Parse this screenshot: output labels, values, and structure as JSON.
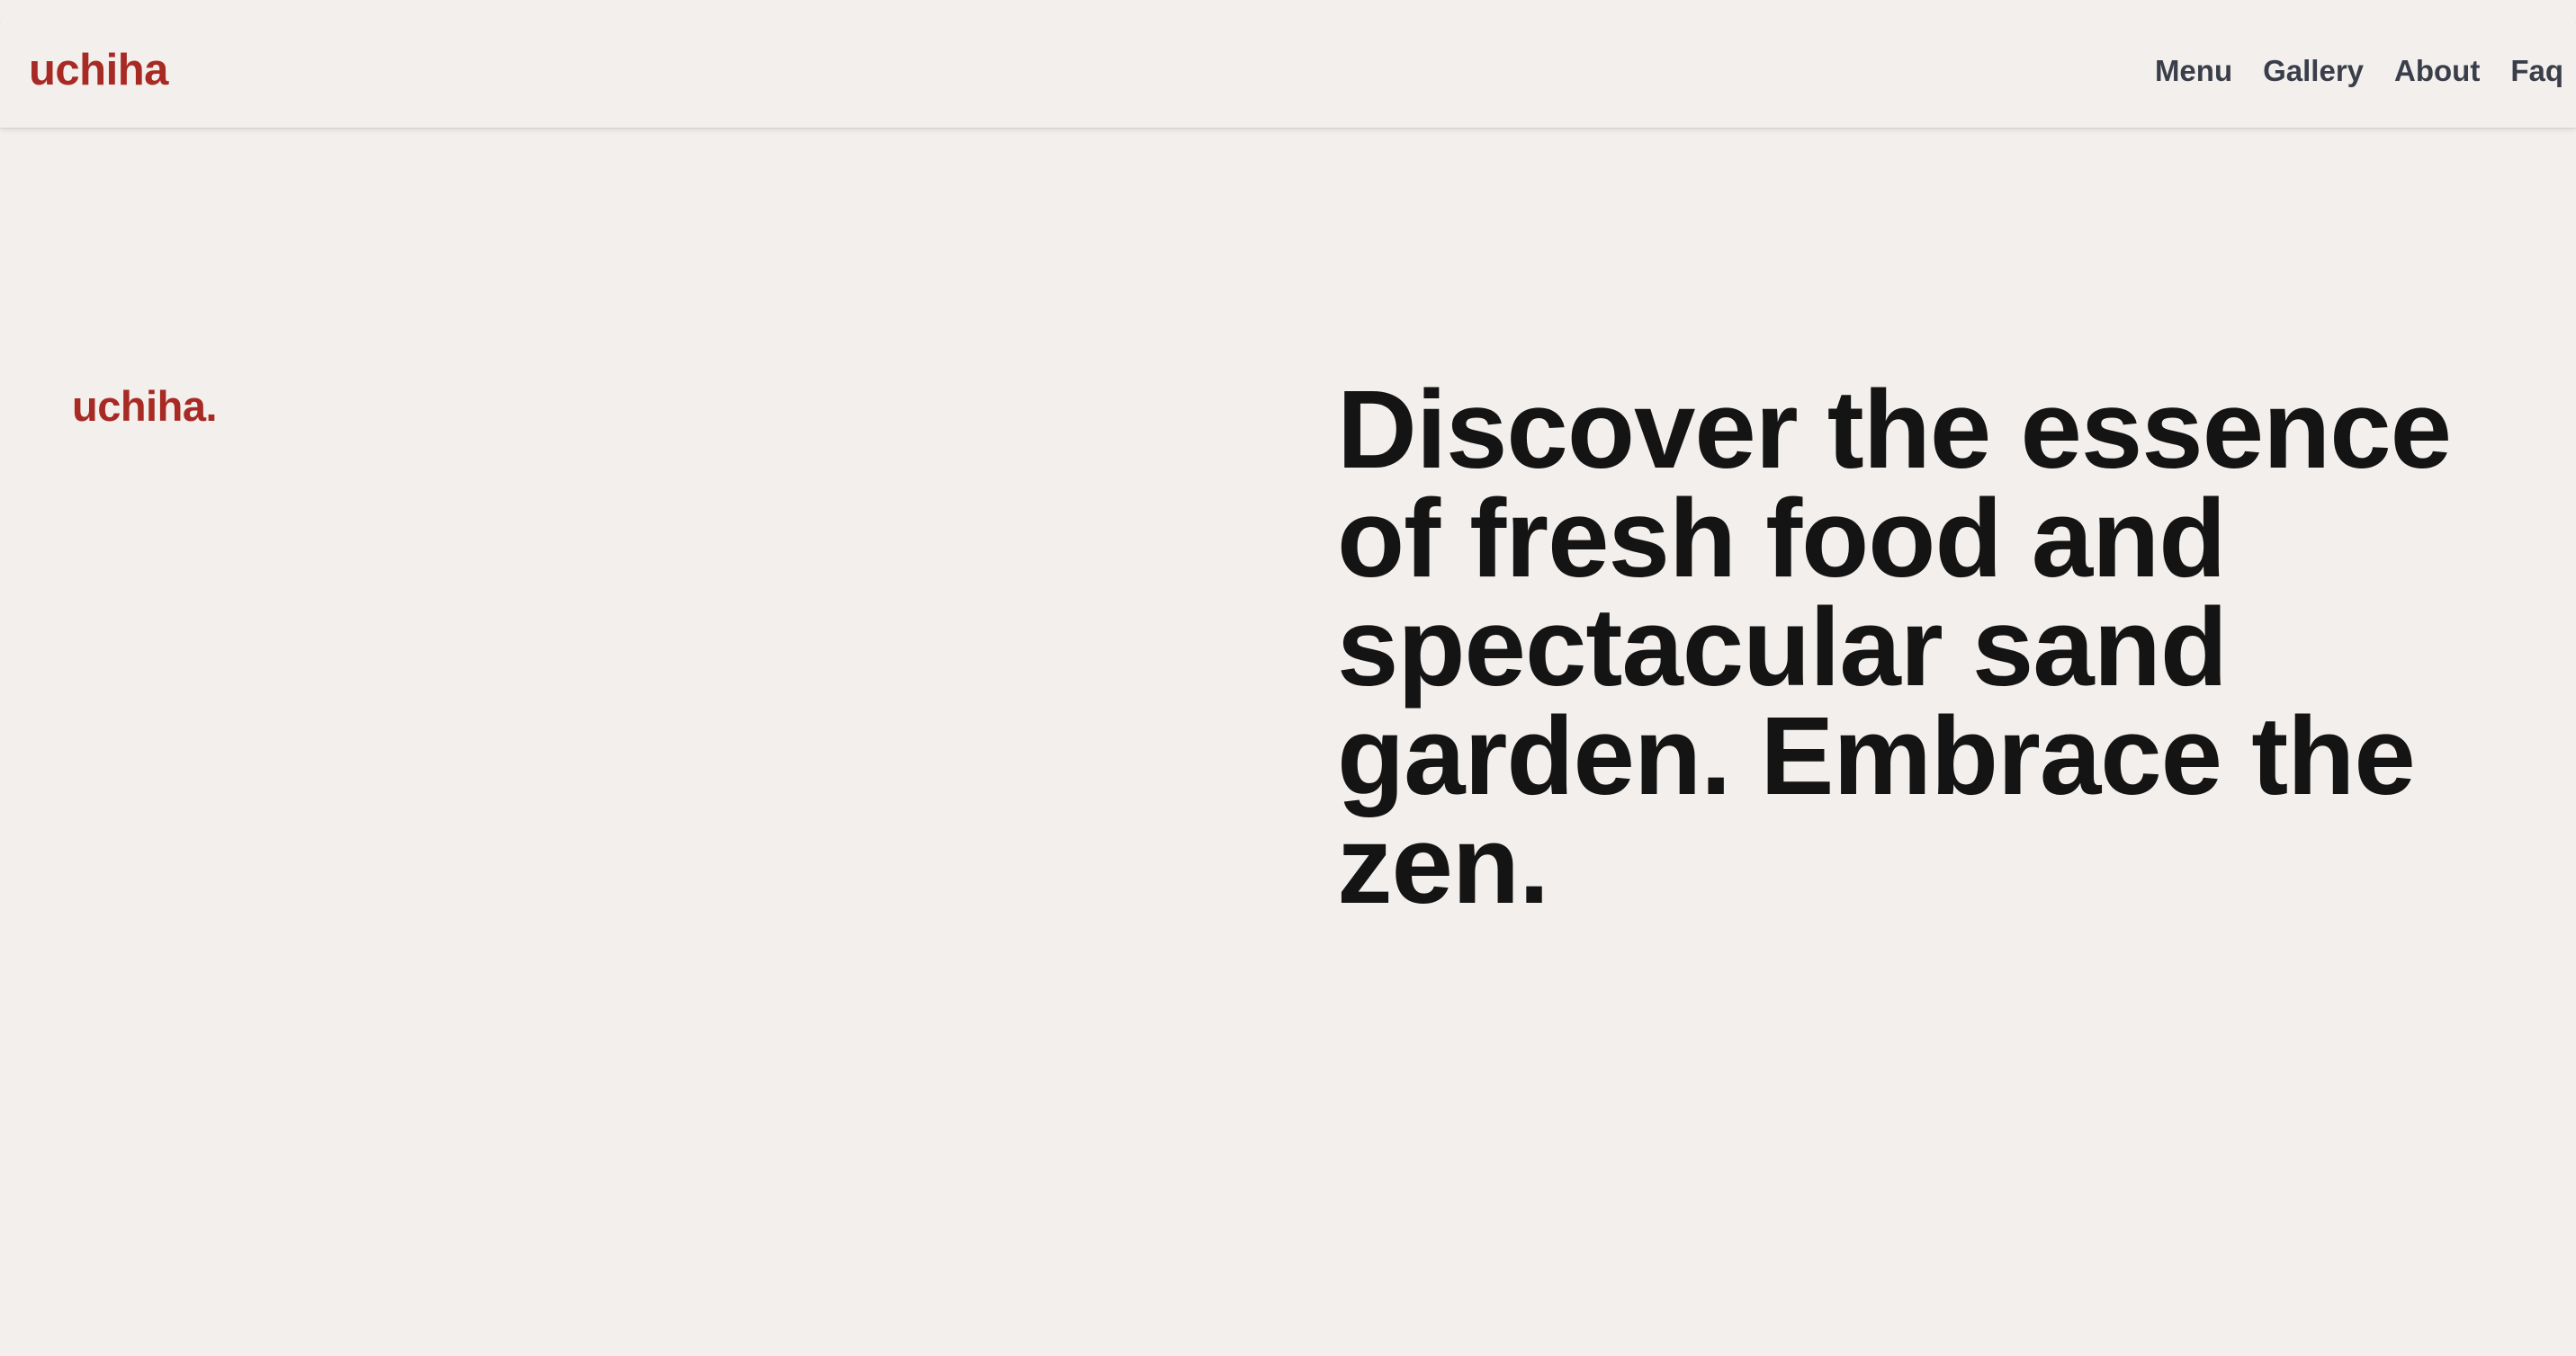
{
  "header": {
    "brand": "uchiha",
    "nav": [
      "Menu",
      "Gallery",
      "About",
      "Faq"
    ]
  },
  "hero": {
    "logo": "uchiha.",
    "headline": "Discover the essence of fresh food and spectacular sand garden. Embrace the zen."
  },
  "colors": {
    "background": "#f2efec",
    "brand": "#a82a24",
    "nav_text": "#3a3e4a",
    "headline": "#141414"
  }
}
